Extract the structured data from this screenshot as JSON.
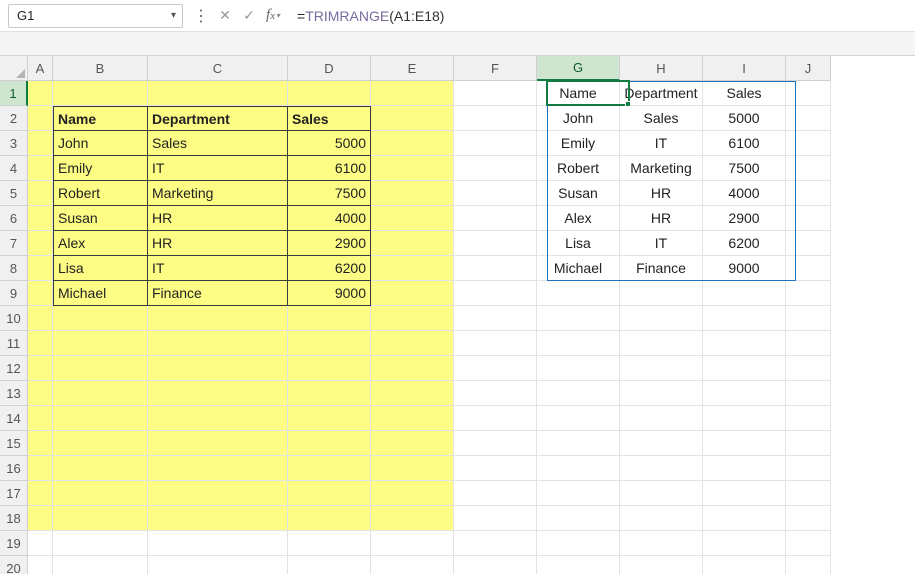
{
  "namebox": {
    "value": "G1"
  },
  "formula": {
    "prefix": "=",
    "fn": "TRIMRANGE",
    "args": "(A1:E18)"
  },
  "columns": [
    "A",
    "B",
    "C",
    "D",
    "E",
    "F",
    "G",
    "H",
    "I",
    "J"
  ],
  "rows": [
    "1",
    "2",
    "3",
    "4",
    "5",
    "6",
    "7",
    "8",
    "9",
    "10",
    "11",
    "12",
    "13",
    "14",
    "15",
    "16",
    "17",
    "18",
    "19",
    "20"
  ],
  "active_col": "G",
  "active_row": "1",
  "source_table": {
    "headers": [
      "Name",
      "Department",
      "Sales"
    ],
    "rows": [
      [
        "John",
        "Sales",
        "5000"
      ],
      [
        "Emily",
        "IT",
        "6100"
      ],
      [
        "Robert",
        "Marketing",
        "7500"
      ],
      [
        "Susan",
        "HR",
        "4000"
      ],
      [
        "Alex",
        "HR",
        "2900"
      ],
      [
        "Lisa",
        "IT",
        "6200"
      ],
      [
        "Michael",
        "Finance",
        "9000"
      ]
    ]
  },
  "spill_table": {
    "headers": [
      "Name",
      "Department",
      "Sales"
    ],
    "rows": [
      [
        "John",
        "Sales",
        "5000"
      ],
      [
        "Emily",
        "IT",
        "6100"
      ],
      [
        "Robert",
        "Marketing",
        "7500"
      ],
      [
        "Susan",
        "HR",
        "4000"
      ],
      [
        "Alex",
        "HR",
        "2900"
      ],
      [
        "Lisa",
        "IT",
        "6200"
      ],
      [
        "Michael",
        "Finance",
        "9000"
      ]
    ]
  }
}
